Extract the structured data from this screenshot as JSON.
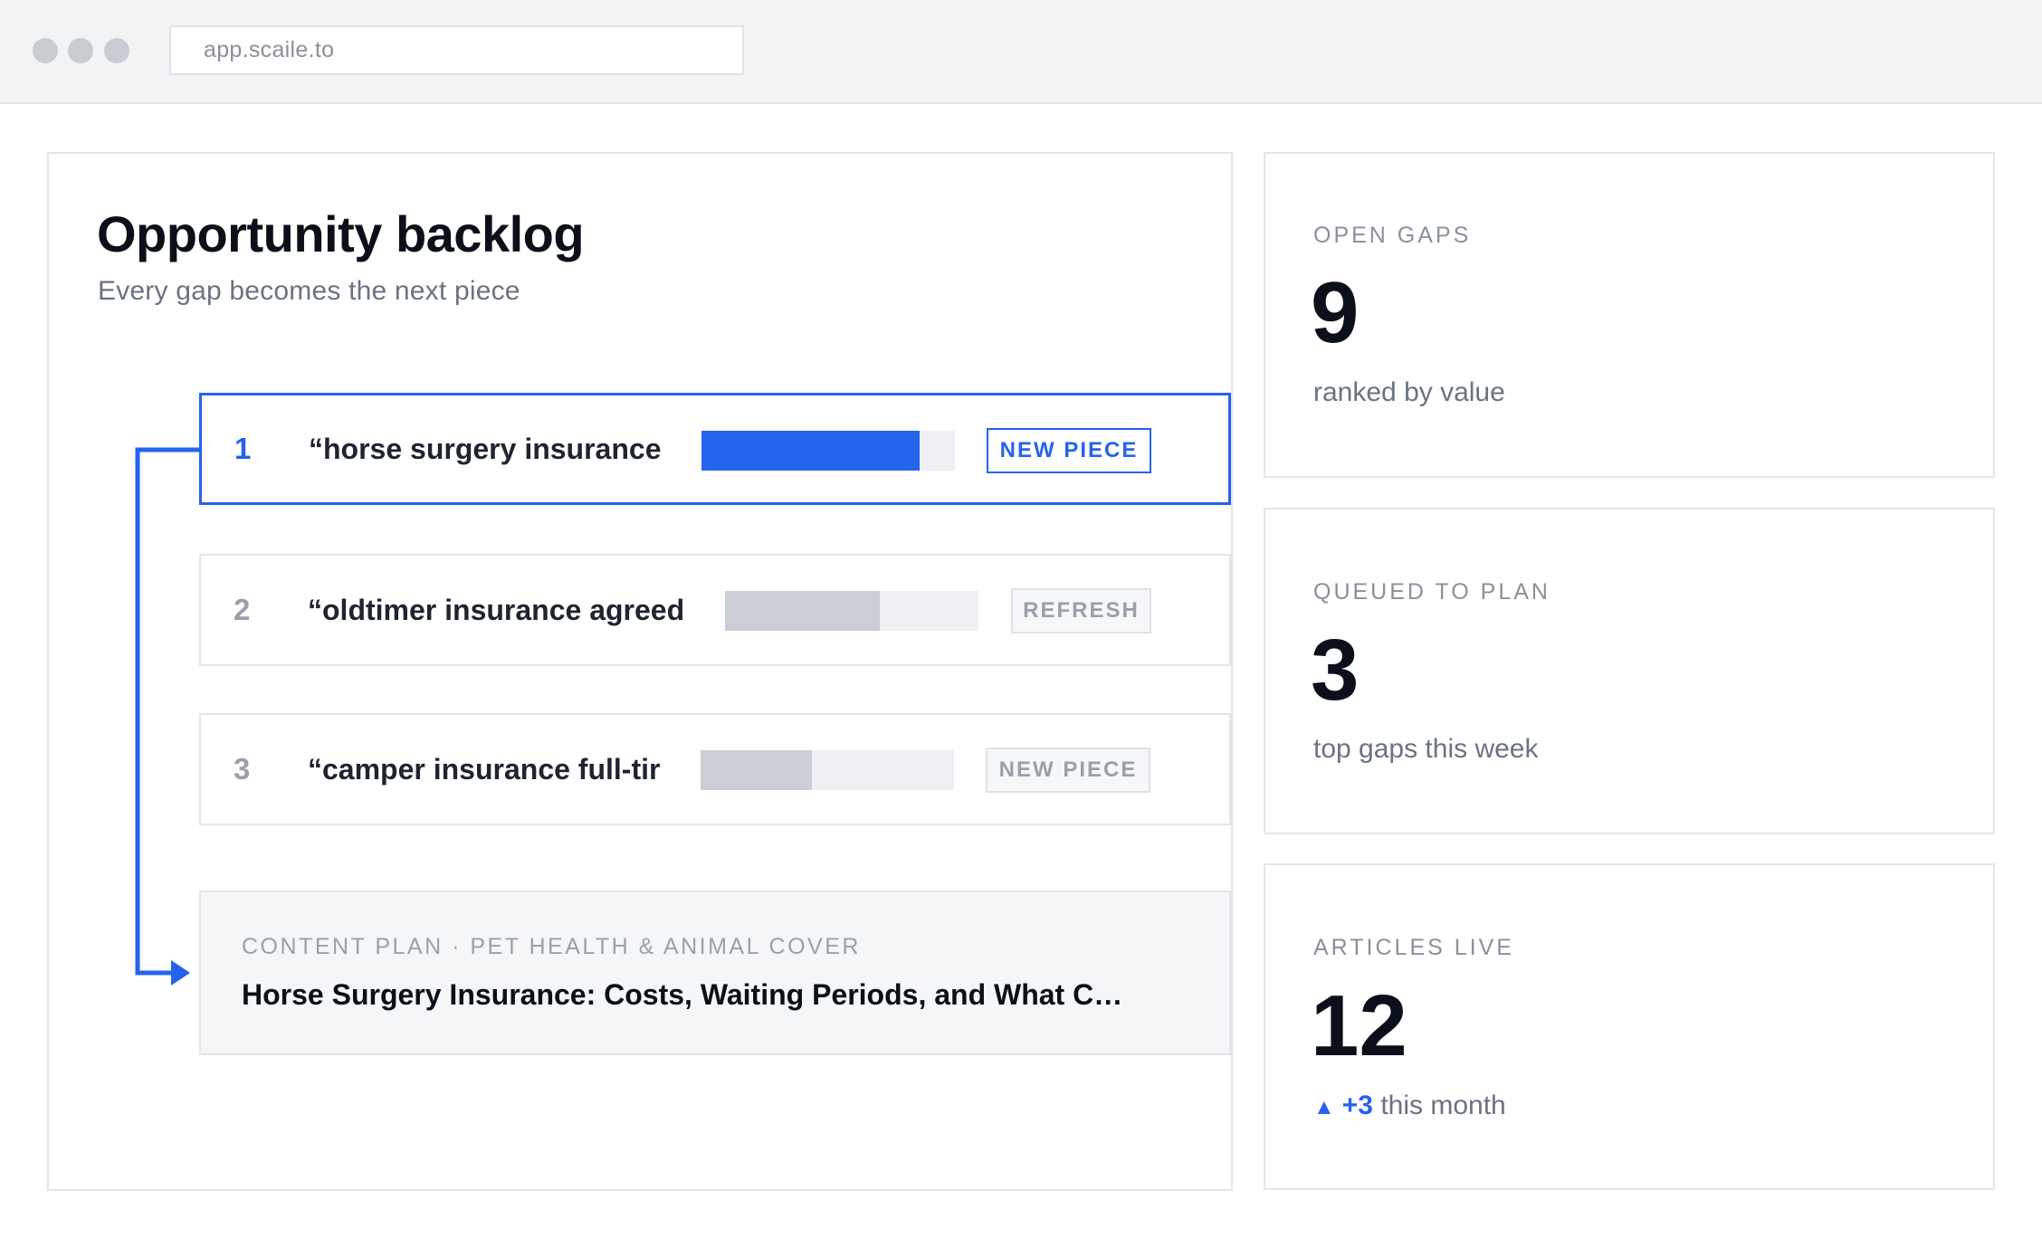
{
  "browser": {
    "address": "app.scaile.to"
  },
  "backlog": {
    "title": "Opportunity backlog",
    "subtitle": "Every gap becomes the next piece",
    "rows": [
      {
        "rank": "1",
        "query": "“horse surgery insurance",
        "score": 0.86,
        "action": "NEW PIECE"
      },
      {
        "rank": "2",
        "query": "“oldtimer insurance agreed",
        "score": 0.61,
        "action": "REFRESH"
      },
      {
        "rank": "3",
        "query": "“camper insurance full-tir",
        "score": 0.44,
        "action": "NEW PIECE"
      }
    ],
    "plan": {
      "label": "CONTENT PLAN · PET HEALTH & ANIMAL COVER",
      "title": "Horse Surgery Insurance: Costs, Waiting Periods, and What C…"
    }
  },
  "stats": [
    {
      "label": "OPEN GAPS",
      "value": "9",
      "caption": "ranked by value"
    },
    {
      "label": "QUEUED TO PLAN",
      "value": "3",
      "caption": "top gaps this week"
    },
    {
      "label": "ARTICLES LIVE",
      "value": "12",
      "delta_icon": "▲",
      "delta": "+3",
      "caption": "this month"
    }
  ],
  "colors": {
    "accent": "#2563eb",
    "muted_bar": "#cbced4",
    "track": "#eef0f3"
  },
  "icons": {
    "connector": "flow-arrow-icon",
    "delta": "triangle-up-icon"
  }
}
